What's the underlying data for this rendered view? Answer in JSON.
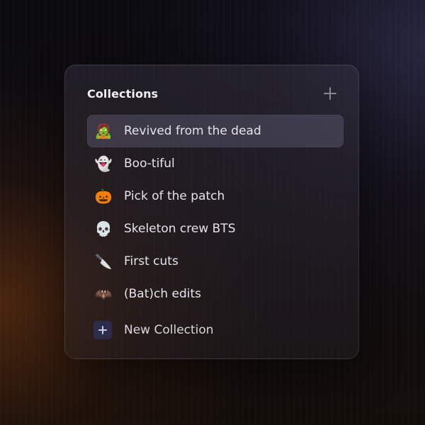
{
  "panel": {
    "title": "Collections",
    "add_icon": "plus-icon"
  },
  "collections": [
    {
      "emoji": "🧟",
      "icon": "zombie-icon",
      "label": "Revived from the dead",
      "selected": true
    },
    {
      "emoji": "👻",
      "icon": "ghost-icon",
      "label": "Boo-tiful",
      "selected": false
    },
    {
      "emoji": "🎃",
      "icon": "pumpkin-icon",
      "label": "Pick of the patch",
      "selected": false
    },
    {
      "emoji": "💀",
      "icon": "skull-icon",
      "label": "Skeleton crew BTS",
      "selected": false
    },
    {
      "emoji": "🔪",
      "icon": "knife-icon",
      "label": "First cuts",
      "selected": false
    },
    {
      "emoji": "🦇",
      "icon": "bat-icon",
      "label": "(Bat)ch edits",
      "selected": false
    }
  ],
  "new_collection": {
    "label": "New Collection",
    "icon": "plus-icon"
  },
  "colors": {
    "selected_row": "#4a4858",
    "new_icon_bg": "#2c2c4c",
    "text": "#e6e3ec"
  }
}
